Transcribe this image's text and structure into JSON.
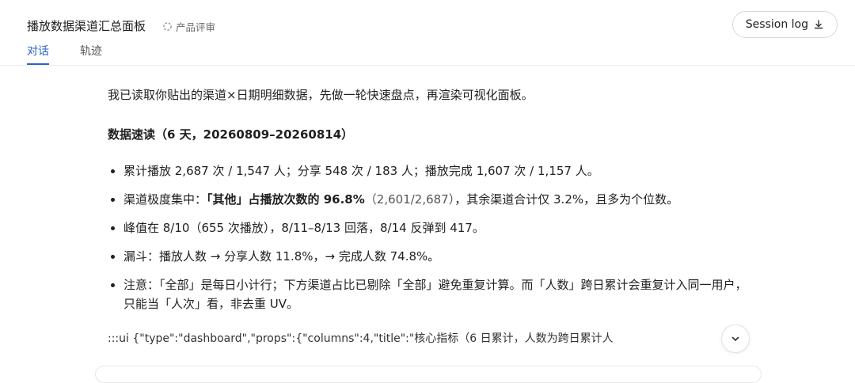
{
  "header": {
    "title": "播放数据渠道汇总面板",
    "review_label": "产品评审",
    "session_button": "Session log",
    "tabs": [
      {
        "label": "对话",
        "active": true
      },
      {
        "label": "轨迹",
        "active": false
      }
    ]
  },
  "message": {
    "intro": "我已读取你贴出的渠道×日期明细数据，先做一轮快速盘点，再渲染可视化面板。",
    "section_title": "数据速读（6 天，20260809–20260814）",
    "bullets": {
      "b1": "累计播放 2,687 次 / 1,547 人；分享 548 次 / 183 人；播放完成 1,607 次 / 1,157 人。",
      "b2_pre": "渠道极度集中：",
      "b2_bold": "「其他」占播放次数的 96.8%",
      "b2_muted": "（2,601/2,687）",
      "b2_post": "，其余渠道合计仅 3.2%，且多为个位数。",
      "b3": "峰值在 8/10（655 次播放），8/11–8/13 回落，8/14 反弹到 417。",
      "b4": "漏斗：播放人数 → 分享人数 11.8%，→ 完成人数 74.8%。",
      "b5": "注意：「全部」是每日小计行；下方渠道占比已剔除「全部」避免重复计算。而「人数」跨日累计会重复计入同一用户，只能当「人次」看，非去重 UV。"
    },
    "ui_line": ":::ui {\"type\":\"dashboard\",\"props\":{\"columns\":4,\"title\":\"核心指标（6 日累计，人数为跨日累计人"
  },
  "colors": {
    "accent": "#2a63c9",
    "text": "#1f1f1f",
    "muted": "#6b6b6b"
  }
}
